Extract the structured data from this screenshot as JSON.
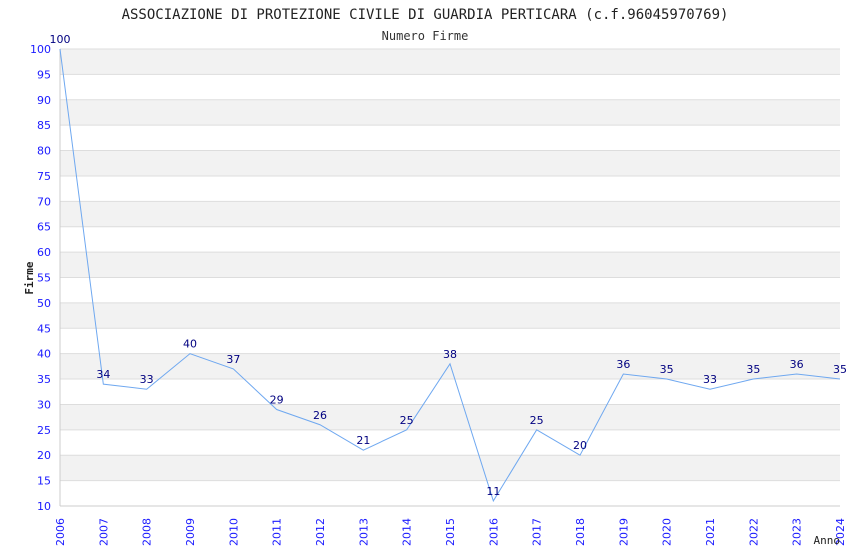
{
  "chart_data": {
    "type": "line",
    "title": "ASSOCIAZIONE DI PROTEZIONE CIVILE DI GUARDIA PERTICARA (c.f.96045970769)",
    "subtitle": "Numero Firme",
    "xlabel": "Anno",
    "ylabel": "Firme",
    "x": [
      2006,
      2007,
      2008,
      2009,
      2010,
      2011,
      2012,
      2013,
      2014,
      2015,
      2016,
      2017,
      2018,
      2019,
      2020,
      2021,
      2022,
      2023,
      2024
    ],
    "values": [
      100,
      34,
      33,
      40,
      37,
      29,
      26,
      21,
      25,
      38,
      11,
      25,
      20,
      36,
      35,
      33,
      35,
      36,
      35
    ],
    "xlim": [
      2006,
      2024
    ],
    "ylim": [
      10,
      100
    ],
    "ytick_step": 5,
    "grid": true,
    "colors": {
      "line": "#6fa8f0",
      "band": "#f2f2f2",
      "grid": "#dddddd",
      "tick": "#1a1aff",
      "label": "#000080"
    }
  }
}
